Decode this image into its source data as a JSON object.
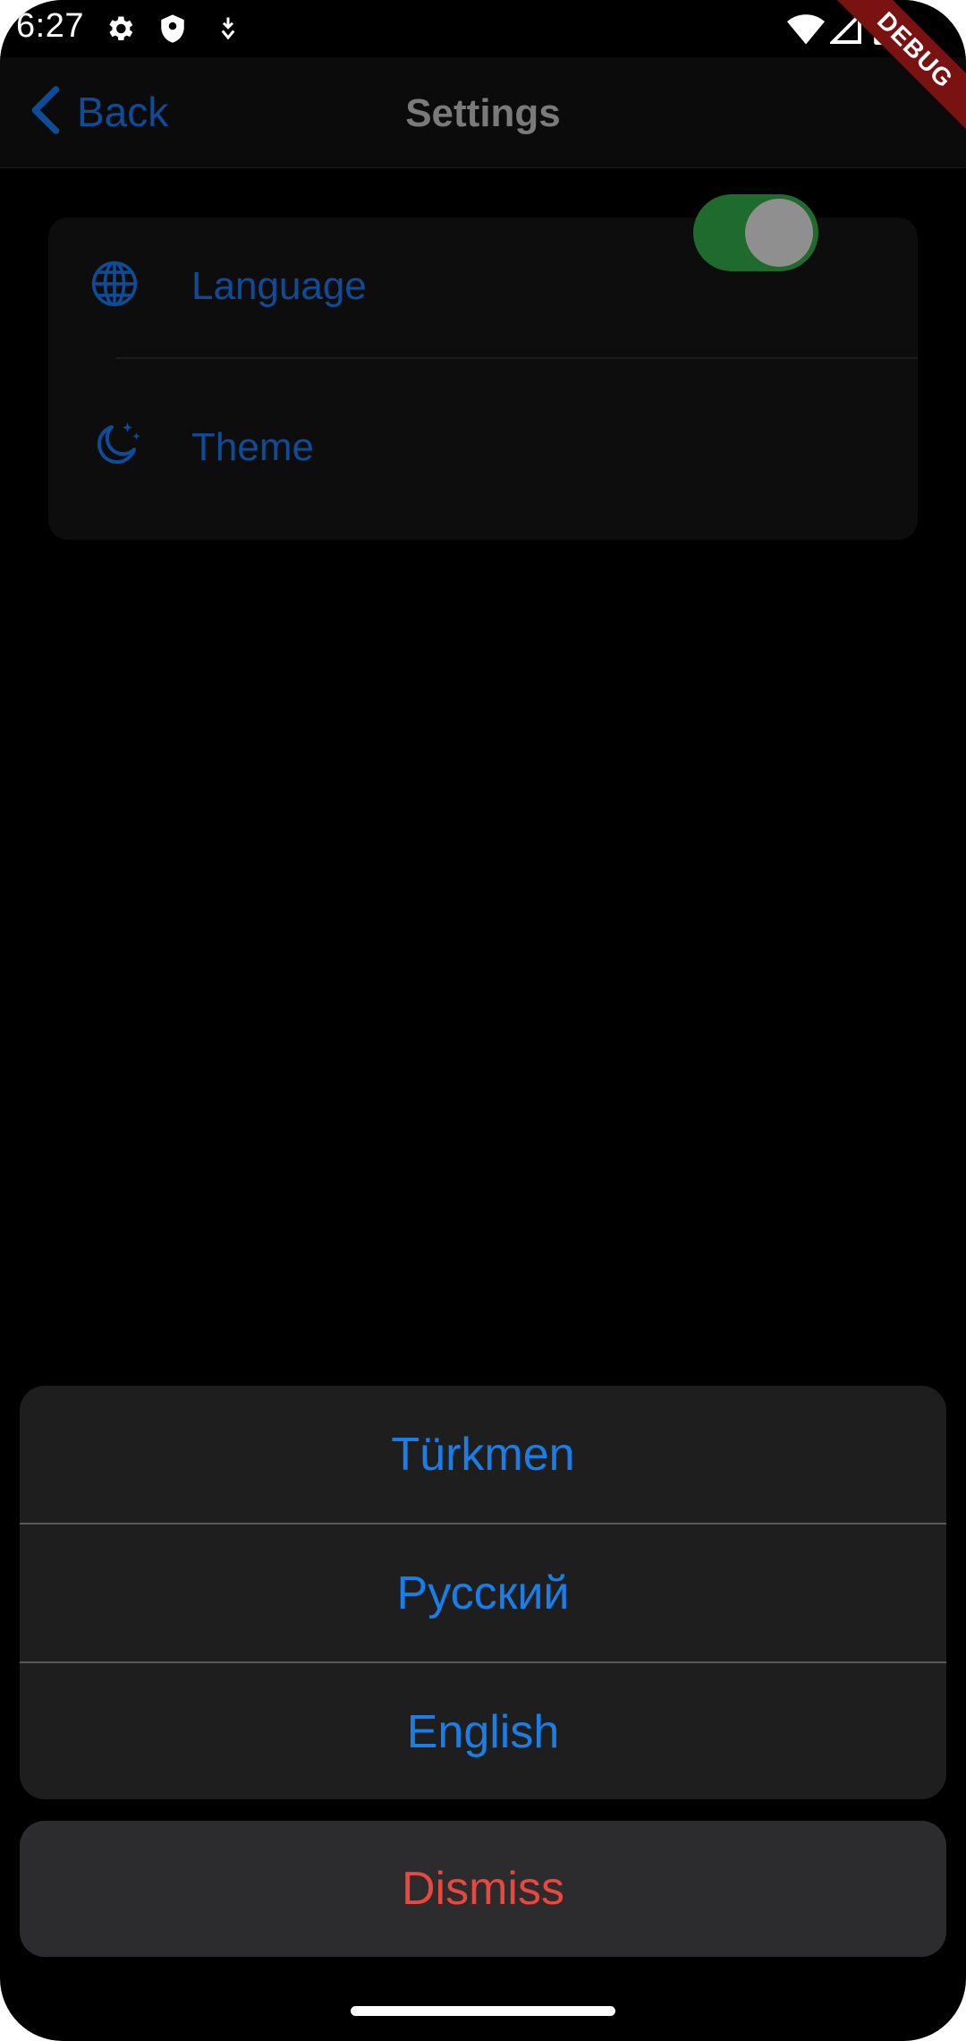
{
  "status_bar": {
    "time": "6:27",
    "icons": [
      "gear-icon",
      "shield-icon",
      "download-icon",
      "wifi-icon",
      "signal-icon",
      "battery-icon"
    ]
  },
  "debug_banner": {
    "text": "DEBUG"
  },
  "app_bar": {
    "back_label": "Back",
    "title": "Settings"
  },
  "settings": {
    "items": [
      {
        "label": "Language",
        "icon": "globe-icon"
      },
      {
        "label": "Theme",
        "icon": "moon-stars-icon",
        "toggle_on": true
      }
    ]
  },
  "action_sheet": {
    "options": [
      {
        "label": "Türkmen"
      },
      {
        "label": "Русский"
      },
      {
        "label": "English"
      }
    ],
    "dismiss_label": "Dismiss"
  },
  "colors": {
    "accent": "#0f4c97",
    "sheet_option": "#1a7ee8",
    "destructive": "#e8483e",
    "toggle_track": "#1f6b2e",
    "debug_ribbon": "#7a1212"
  }
}
